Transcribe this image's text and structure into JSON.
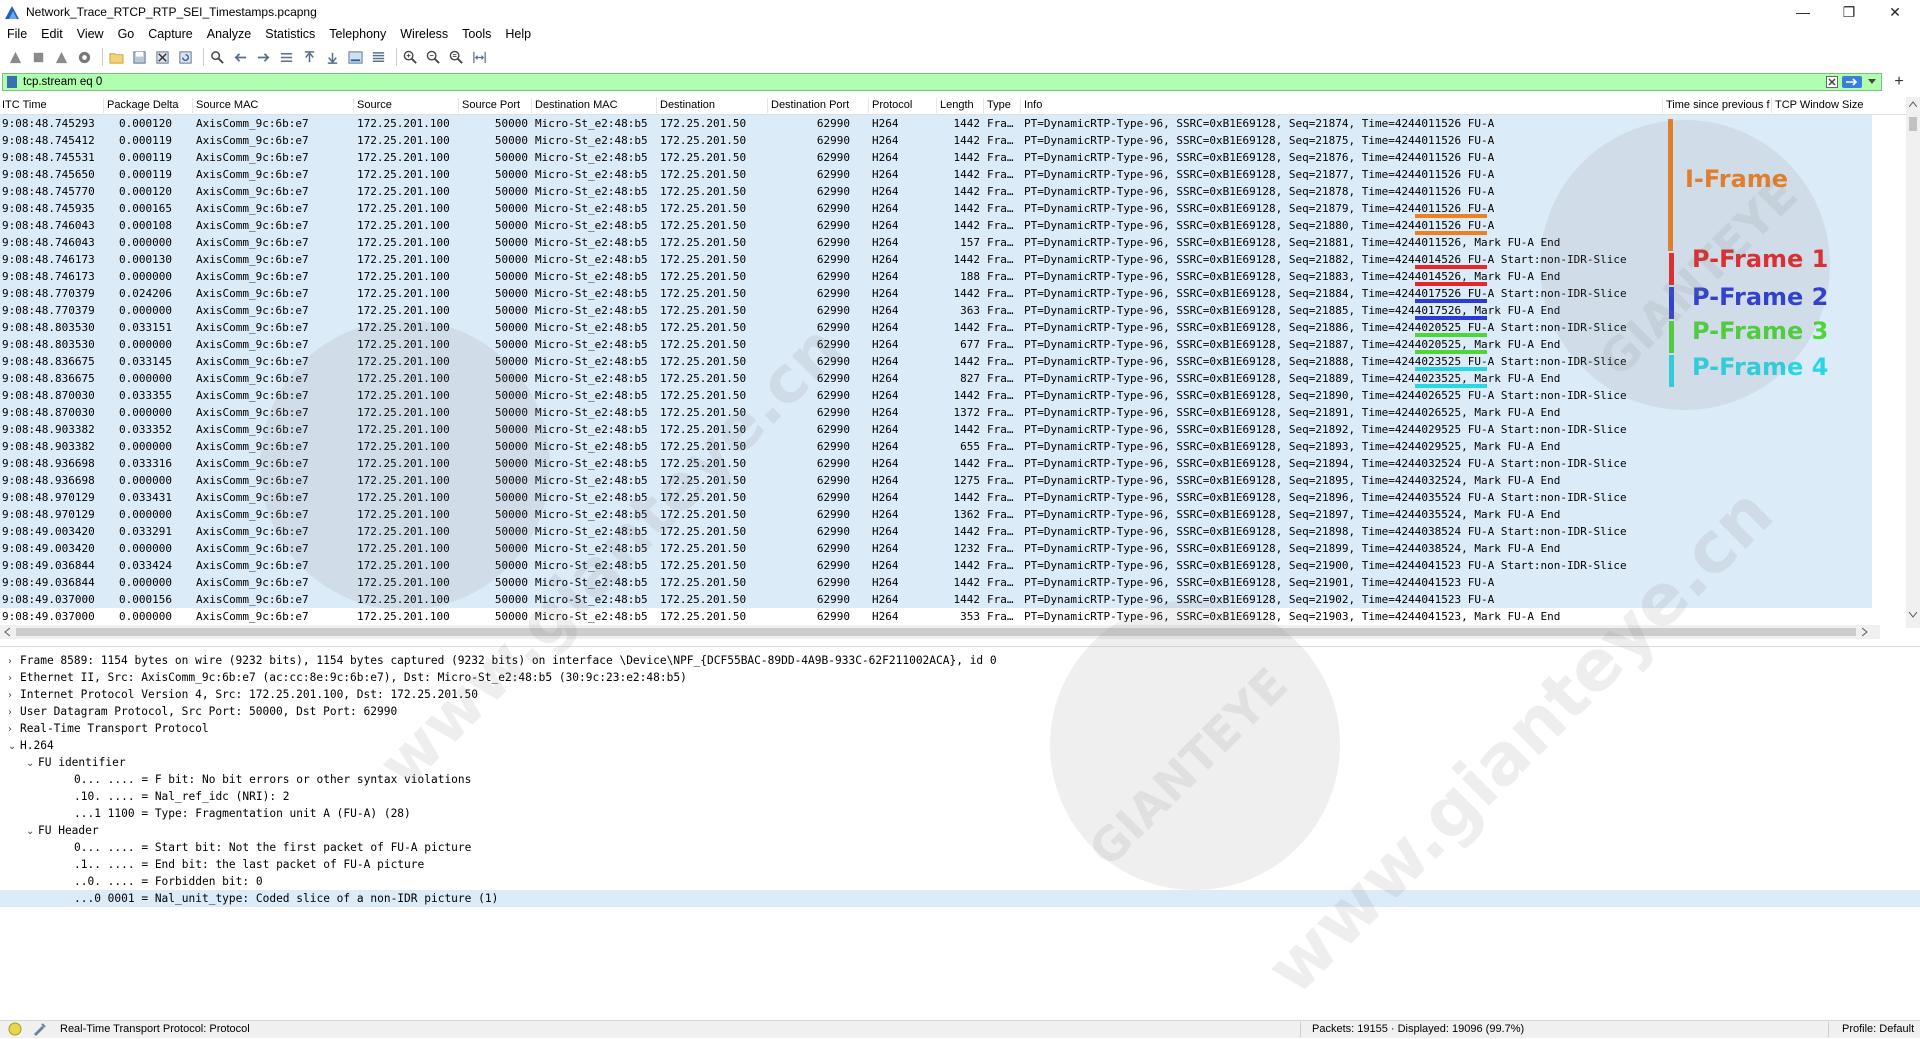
{
  "window": {
    "title": "Network_Trace_RTCP_RTP_SEI_Timestamps.pcapng",
    "controls": [
      "minimize",
      "restore",
      "close"
    ]
  },
  "menu": [
    "File",
    "Edit",
    "View",
    "Go",
    "Capture",
    "Analyze",
    "Statistics",
    "Telephony",
    "Wireless",
    "Tools",
    "Help"
  ],
  "toolbar": {
    "icons": [
      "shark-fin-start-icon",
      "stop-square-icon",
      "restart-icon",
      "capture-options-icon",
      "open-folder-icon",
      "save-icon",
      "close-file-icon",
      "reload-icon",
      "find-icon",
      "go-back-icon",
      "go-forward-icon",
      "go-to-packet-icon",
      "first-packet-icon",
      "last-packet-icon",
      "autoscroll-icon",
      "colorize-icon",
      "zoom-in-icon",
      "zoom-out-icon",
      "zoom-normal-icon",
      "resize-columns-icon"
    ]
  },
  "filter": {
    "value": "tcp.stream eq 0",
    "accent": "#afffaf"
  },
  "columns": [
    "ITC Time",
    "Package Delta",
    "Source MAC",
    "Source",
    "Source Port",
    "Destination MAC",
    "Destination",
    "Destination Port",
    "Protocol",
    "Length",
    "Type",
    "Info",
    "Time since previous f",
    "TCP Window Size"
  ],
  "packets": [
    {
      "time": "9:08:48.745293",
      "delta": "0.000120",
      "smac": "AxisComm_9c:6b:e7",
      "src": "172.25.201.100",
      "sport": "50000",
      "dmac": "Micro-St_e2:48:b5",
      "dst": "172.25.201.50",
      "dport": "62990",
      "proto": "H264",
      "len": "1442",
      "type": "Fra…",
      "info": "PT=DynamicRTP-Type-96, SSRC=0xB1E69128, Seq=21874, Time=4244011526 FU-A"
    },
    {
      "time": "9:08:48.745412",
      "delta": "0.000119",
      "smac": "AxisComm_9c:6b:e7",
      "src": "172.25.201.100",
      "sport": "50000",
      "dmac": "Micro-St_e2:48:b5",
      "dst": "172.25.201.50",
      "dport": "62990",
      "proto": "H264",
      "len": "1442",
      "type": "Fra…",
      "info": "PT=DynamicRTP-Type-96, SSRC=0xB1E69128, Seq=21875, Time=4244011526 FU-A"
    },
    {
      "time": "9:08:48.745531",
      "delta": "0.000119",
      "smac": "AxisComm_9c:6b:e7",
      "src": "172.25.201.100",
      "sport": "50000",
      "dmac": "Micro-St_e2:48:b5",
      "dst": "172.25.201.50",
      "dport": "62990",
      "proto": "H264",
      "len": "1442",
      "type": "Fra…",
      "info": "PT=DynamicRTP-Type-96, SSRC=0xB1E69128, Seq=21876, Time=4244011526 FU-A"
    },
    {
      "time": "9:08:48.745650",
      "delta": "0.000119",
      "smac": "AxisComm_9c:6b:e7",
      "src": "172.25.201.100",
      "sport": "50000",
      "dmac": "Micro-St_e2:48:b5",
      "dst": "172.25.201.50",
      "dport": "62990",
      "proto": "H264",
      "len": "1442",
      "type": "Fra…",
      "info": "PT=DynamicRTP-Type-96, SSRC=0xB1E69128, Seq=21877, Time=4244011526 FU-A"
    },
    {
      "time": "9:08:48.745770",
      "delta": "0.000120",
      "smac": "AxisComm_9c:6b:e7",
      "src": "172.25.201.100",
      "sport": "50000",
      "dmac": "Micro-St_e2:48:b5",
      "dst": "172.25.201.50",
      "dport": "62990",
      "proto": "H264",
      "len": "1442",
      "type": "Fra…",
      "info": "PT=DynamicRTP-Type-96, SSRC=0xB1E69128, Seq=21878, Time=4244011526 FU-A"
    },
    {
      "time": "9:08:48.745935",
      "delta": "0.000165",
      "smac": "AxisComm_9c:6b:e7",
      "src": "172.25.201.100",
      "sport": "50000",
      "dmac": "Micro-St_e2:48:b5",
      "dst": "172.25.201.50",
      "dport": "62990",
      "proto": "H264",
      "len": "1442",
      "type": "Fra…",
      "info": "PT=DynamicRTP-Type-96, SSRC=0xB1E69128, Seq=21879, Time=4244011526 FU-A"
    },
    {
      "time": "9:08:48.746043",
      "delta": "0.000108",
      "smac": "AxisComm_9c:6b:e7",
      "src": "172.25.201.100",
      "sport": "50000",
      "dmac": "Micro-St_e2:48:b5",
      "dst": "172.25.201.50",
      "dport": "62990",
      "proto": "H264",
      "len": "1442",
      "type": "Fra…",
      "info": "PT=DynamicRTP-Type-96, SSRC=0xB1E69128, Seq=21880, Time=4244011526 FU-A"
    },
    {
      "time": "9:08:48.746043",
      "delta": "0.000000",
      "smac": "AxisComm_9c:6b:e7",
      "src": "172.25.201.100",
      "sport": "50000",
      "dmac": "Micro-St_e2:48:b5",
      "dst": "172.25.201.50",
      "dport": "62990",
      "proto": "H264",
      "len": "157",
      "type": "Fra…",
      "info": "PT=DynamicRTP-Type-96, SSRC=0xB1E69128, Seq=21881, Time=4244011526, Mark FU-A End"
    },
    {
      "time": "9:08:48.746173",
      "delta": "0.000130",
      "smac": "AxisComm_9c:6b:e7",
      "src": "172.25.201.100",
      "sport": "50000",
      "dmac": "Micro-St_e2:48:b5",
      "dst": "172.25.201.50",
      "dport": "62990",
      "proto": "H264",
      "len": "1442",
      "type": "Fra…",
      "info": "PT=DynamicRTP-Type-96, SSRC=0xB1E69128, Seq=21882, Time=4244014526 FU-A Start:non-IDR-Slice"
    },
    {
      "time": "9:08:48.746173",
      "delta": "0.000000",
      "smac": "AxisComm_9c:6b:e7",
      "src": "172.25.201.100",
      "sport": "50000",
      "dmac": "Micro-St_e2:48:b5",
      "dst": "172.25.201.50",
      "dport": "62990",
      "proto": "H264",
      "len": "188",
      "type": "Fra…",
      "info": "PT=DynamicRTP-Type-96, SSRC=0xB1E69128, Seq=21883, Time=4244014526, Mark FU-A End"
    },
    {
      "time": "9:08:48.770379",
      "delta": "0.024206",
      "smac": "AxisComm_9c:6b:e7",
      "src": "172.25.201.100",
      "sport": "50000",
      "dmac": "Micro-St_e2:48:b5",
      "dst": "172.25.201.50",
      "dport": "62990",
      "proto": "H264",
      "len": "1442",
      "type": "Fra…",
      "info": "PT=DynamicRTP-Type-96, SSRC=0xB1E69128, Seq=21884, Time=4244017526 FU-A Start:non-IDR-Slice"
    },
    {
      "time": "9:08:48.770379",
      "delta": "0.000000",
      "smac": "AxisComm_9c:6b:e7",
      "src": "172.25.201.100",
      "sport": "50000",
      "dmac": "Micro-St_e2:48:b5",
      "dst": "172.25.201.50",
      "dport": "62990",
      "proto": "H264",
      "len": "363",
      "type": "Fra…",
      "info": "PT=DynamicRTP-Type-96, SSRC=0xB1E69128, Seq=21885, Time=4244017526, Mark FU-A End"
    },
    {
      "time": "9:08:48.803530",
      "delta": "0.033151",
      "smac": "AxisComm_9c:6b:e7",
      "src": "172.25.201.100",
      "sport": "50000",
      "dmac": "Micro-St_e2:48:b5",
      "dst": "172.25.201.50",
      "dport": "62990",
      "proto": "H264",
      "len": "1442",
      "type": "Fra…",
      "info": "PT=DynamicRTP-Type-96, SSRC=0xB1E69128, Seq=21886, Time=4244020525 FU-A Start:non-IDR-Slice"
    },
    {
      "time": "9:08:48.803530",
      "delta": "0.000000",
      "smac": "AxisComm_9c:6b:e7",
      "src": "172.25.201.100",
      "sport": "50000",
      "dmac": "Micro-St_e2:48:b5",
      "dst": "172.25.201.50",
      "dport": "62990",
      "proto": "H264",
      "len": "677",
      "type": "Fra…",
      "info": "PT=DynamicRTP-Type-96, SSRC=0xB1E69128, Seq=21887, Time=4244020525, Mark FU-A End"
    },
    {
      "time": "9:08:48.836675",
      "delta": "0.033145",
      "smac": "AxisComm_9c:6b:e7",
      "src": "172.25.201.100",
      "sport": "50000",
      "dmac": "Micro-St_e2:48:b5",
      "dst": "172.25.201.50",
      "dport": "62990",
      "proto": "H264",
      "len": "1442",
      "type": "Fra…",
      "info": "PT=DynamicRTP-Type-96, SSRC=0xB1E69128, Seq=21888, Time=4244023525 FU-A Start:non-IDR-Slice"
    },
    {
      "time": "9:08:48.836675",
      "delta": "0.000000",
      "smac": "AxisComm_9c:6b:e7",
      "src": "172.25.201.100",
      "sport": "50000",
      "dmac": "Micro-St_e2:48:b5",
      "dst": "172.25.201.50",
      "dport": "62990",
      "proto": "H264",
      "len": "827",
      "type": "Fra…",
      "info": "PT=DynamicRTP-Type-96, SSRC=0xB1E69128, Seq=21889, Time=4244023525, Mark FU-A End"
    },
    {
      "time": "9:08:48.870030",
      "delta": "0.033355",
      "smac": "AxisComm_9c:6b:e7",
      "src": "172.25.201.100",
      "sport": "50000",
      "dmac": "Micro-St_e2:48:b5",
      "dst": "172.25.201.50",
      "dport": "62990",
      "proto": "H264",
      "len": "1442",
      "type": "Fra…",
      "info": "PT=DynamicRTP-Type-96, SSRC=0xB1E69128, Seq=21890, Time=4244026525 FU-A Start:non-IDR-Slice"
    },
    {
      "time": "9:08:48.870030",
      "delta": "0.000000",
      "smac": "AxisComm_9c:6b:e7",
      "src": "172.25.201.100",
      "sport": "50000",
      "dmac": "Micro-St_e2:48:b5",
      "dst": "172.25.201.50",
      "dport": "62990",
      "proto": "H264",
      "len": "1372",
      "type": "Fra…",
      "info": "PT=DynamicRTP-Type-96, SSRC=0xB1E69128, Seq=21891, Time=4244026525, Mark FU-A End"
    },
    {
      "time": "9:08:48.903382",
      "delta": "0.033352",
      "smac": "AxisComm_9c:6b:e7",
      "src": "172.25.201.100",
      "sport": "50000",
      "dmac": "Micro-St_e2:48:b5",
      "dst": "172.25.201.50",
      "dport": "62990",
      "proto": "H264",
      "len": "1442",
      "type": "Fra…",
      "info": "PT=DynamicRTP-Type-96, SSRC=0xB1E69128, Seq=21892, Time=4244029525 FU-A Start:non-IDR-Slice"
    },
    {
      "time": "9:08:48.903382",
      "delta": "0.000000",
      "smac": "AxisComm_9c:6b:e7",
      "src": "172.25.201.100",
      "sport": "50000",
      "dmac": "Micro-St_e2:48:b5",
      "dst": "172.25.201.50",
      "dport": "62990",
      "proto": "H264",
      "len": "655",
      "type": "Fra…",
      "info": "PT=DynamicRTP-Type-96, SSRC=0xB1E69128, Seq=21893, Time=4244029525, Mark FU-A End"
    },
    {
      "time": "9:08:48.936698",
      "delta": "0.033316",
      "smac": "AxisComm_9c:6b:e7",
      "src": "172.25.201.100",
      "sport": "50000",
      "dmac": "Micro-St_e2:48:b5",
      "dst": "172.25.201.50",
      "dport": "62990",
      "proto": "H264",
      "len": "1442",
      "type": "Fra…",
      "info": "PT=DynamicRTP-Type-96, SSRC=0xB1E69128, Seq=21894, Time=4244032524 FU-A Start:non-IDR-Slice"
    },
    {
      "time": "9:08:48.936698",
      "delta": "0.000000",
      "smac": "AxisComm_9c:6b:e7",
      "src": "172.25.201.100",
      "sport": "50000",
      "dmac": "Micro-St_e2:48:b5",
      "dst": "172.25.201.50",
      "dport": "62990",
      "proto": "H264",
      "len": "1275",
      "type": "Fra…",
      "info": "PT=DynamicRTP-Type-96, SSRC=0xB1E69128, Seq=21895, Time=4244032524, Mark FU-A End"
    },
    {
      "time": "9:08:48.970129",
      "delta": "0.033431",
      "smac": "AxisComm_9c:6b:e7",
      "src": "172.25.201.100",
      "sport": "50000",
      "dmac": "Micro-St_e2:48:b5",
      "dst": "172.25.201.50",
      "dport": "62990",
      "proto": "H264",
      "len": "1442",
      "type": "Fra…",
      "info": "PT=DynamicRTP-Type-96, SSRC=0xB1E69128, Seq=21896, Time=4244035524 FU-A Start:non-IDR-Slice"
    },
    {
      "time": "9:08:48.970129",
      "delta": "0.000000",
      "smac": "AxisComm_9c:6b:e7",
      "src": "172.25.201.100",
      "sport": "50000",
      "dmac": "Micro-St_e2:48:b5",
      "dst": "172.25.201.50",
      "dport": "62990",
      "proto": "H264",
      "len": "1362",
      "type": "Fra…",
      "info": "PT=DynamicRTP-Type-96, SSRC=0xB1E69128, Seq=21897, Time=4244035524, Mark FU-A End"
    },
    {
      "time": "9:08:49.003420",
      "delta": "0.033291",
      "smac": "AxisComm_9c:6b:e7",
      "src": "172.25.201.100",
      "sport": "50000",
      "dmac": "Micro-St_e2:48:b5",
      "dst": "172.25.201.50",
      "dport": "62990",
      "proto": "H264",
      "len": "1442",
      "type": "Fra…",
      "info": "PT=DynamicRTP-Type-96, SSRC=0xB1E69128, Seq=21898, Time=4244038524 FU-A Start:non-IDR-Slice"
    },
    {
      "time": "9:08:49.003420",
      "delta": "0.000000",
      "smac": "AxisComm_9c:6b:e7",
      "src": "172.25.201.100",
      "sport": "50000",
      "dmac": "Micro-St_e2:48:b5",
      "dst": "172.25.201.50",
      "dport": "62990",
      "proto": "H264",
      "len": "1232",
      "type": "Fra…",
      "info": "PT=DynamicRTP-Type-96, SSRC=0xB1E69128, Seq=21899, Time=4244038524, Mark FU-A End"
    },
    {
      "time": "9:08:49.036844",
      "delta": "0.033424",
      "smac": "AxisComm_9c:6b:e7",
      "src": "172.25.201.100",
      "sport": "50000",
      "dmac": "Micro-St_e2:48:b5",
      "dst": "172.25.201.50",
      "dport": "62990",
      "proto": "H264",
      "len": "1442",
      "type": "Fra…",
      "info": "PT=DynamicRTP-Type-96, SSRC=0xB1E69128, Seq=21900, Time=4244041523 FU-A Start:non-IDR-Slice"
    },
    {
      "time": "9:08:49.036844",
      "delta": "0.000000",
      "smac": "AxisComm_9c:6b:e7",
      "src": "172.25.201.100",
      "sport": "50000",
      "dmac": "Micro-St_e2:48:b5",
      "dst": "172.25.201.50",
      "dport": "62990",
      "proto": "H264",
      "len": "1442",
      "type": "Fra…",
      "info": "PT=DynamicRTP-Type-96, SSRC=0xB1E69128, Seq=21901, Time=4244041523 FU-A"
    },
    {
      "time": "9:08:49.037000",
      "delta": "0.000156",
      "smac": "AxisComm_9c:6b:e7",
      "src": "172.25.201.100",
      "sport": "50000",
      "dmac": "Micro-St_e2:48:b5",
      "dst": "172.25.201.50",
      "dport": "62990",
      "proto": "H264",
      "len": "1442",
      "type": "Fra…",
      "info": "PT=DynamicRTP-Type-96, SSRC=0xB1E69128, Seq=21902, Time=4244041523 FU-A"
    },
    {
      "time": "9:08:49.037000",
      "delta": "0.000000",
      "smac": "AxisComm_9c:6b:e7",
      "src": "172.25.201.100",
      "sport": "50000",
      "dmac": "Micro-St_e2:48:b5",
      "dst": "172.25.201.50",
      "dport": "62990",
      "proto": "H264",
      "len": "353",
      "type": "Fra…",
      "info": "PT=DynamicRTP-Type-96, SSRC=0xB1E69128, Seq=21903, Time=4244041523, Mark FU-A End"
    }
  ],
  "annotations": [
    {
      "label": "I-Frame",
      "color": "#f07f22"
    },
    {
      "label": "P-Frame 1",
      "color": "#e8252a"
    },
    {
      "label": "P-Frame 2",
      "color": "#2a3bd6"
    },
    {
      "label": "P-Frame 3",
      "color": "#4cd63a"
    },
    {
      "label": "P-Frame 4",
      "color": "#29d6e6"
    }
  ],
  "details": [
    {
      "text": "Frame 8589: 1154 bytes on wire (9232 bits), 1154 bytes captured (9232 bits) on interface \\Device\\NPF_{DCF55BAC-89DD-4A9B-933C-62F211002ACA}, id 0",
      "arrow": "›"
    },
    {
      "text": "Ethernet II, Src: AxisComm_9c:6b:e7 (ac:cc:8e:9c:6b:e7), Dst: Micro-St_e2:48:b5 (30:9c:23:e2:48:b5)",
      "arrow": "›"
    },
    {
      "text": "Internet Protocol Version 4, Src: 172.25.201.100, Dst: 172.25.201.50",
      "arrow": "›"
    },
    {
      "text": "User Datagram Protocol, Src Port: 50000, Dst Port: 62990",
      "arrow": "›"
    },
    {
      "text": "Real-Time Transport Protocol",
      "arrow": "›"
    },
    {
      "text": "H.264",
      "arrow": "⌄"
    },
    {
      "text": "FU identifier",
      "arrow": "⌄"
    },
    {
      "text": "0... .... = F bit: No bit errors or other syntax violations",
      "arrow": ""
    },
    {
      "text": ".10. .... = Nal_ref_idc (NRI): 2",
      "arrow": ""
    },
    {
      "text": "...1 1100 = Type: Fragmentation unit A (FU-A) (28)",
      "arrow": ""
    },
    {
      "text": "FU Header",
      "arrow": "⌄"
    },
    {
      "text": "0... .... = Start bit: Not the first packet of FU-A picture",
      "arrow": ""
    },
    {
      "text": ".1.. .... = End bit: the last packet of FU-A picture",
      "arrow": ""
    },
    {
      "text": "..0. .... = Forbidden bit: 0",
      "arrow": ""
    },
    {
      "text": "...0 0001 = Nal_unit_type: Coded slice of a non-IDR picture (1)",
      "arrow": ""
    }
  ],
  "status": {
    "left": "Real-Time Transport Protocol: Protocol",
    "packets": "Packets: 19155 · Displayed: 19096 (99.7%)",
    "profile": "Profile: Default"
  },
  "watermark": {
    "site": "www.gianteye.cn",
    "brand": "GIANTEYE"
  }
}
